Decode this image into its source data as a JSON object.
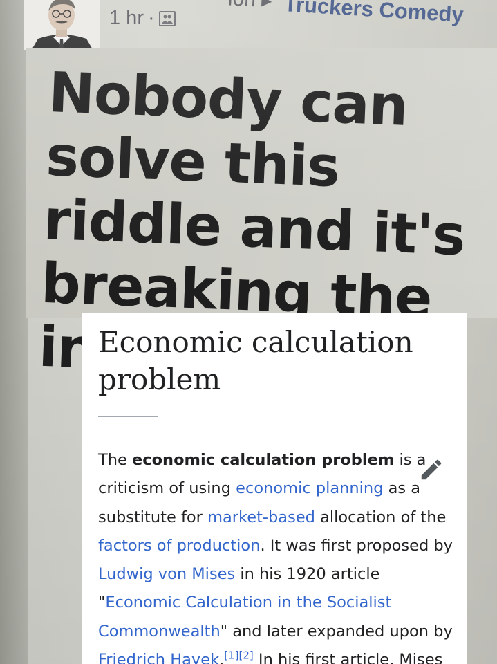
{
  "post": {
    "timestamp": "1 hr",
    "separator": "·",
    "group_name": "Truckers Comedy",
    "headline": "Nobody can solve this riddle and it's breaking the internet"
  },
  "article": {
    "title": "Economic calculation problem",
    "lead": {
      "t1": "The ",
      "bold": "economic calculation problem",
      "t2": " is a criticism of using ",
      "link1": "economic planning",
      "t3": " as a substitute for ",
      "link2": "market-based",
      "t4": " allocation of the ",
      "link3": "factors of production",
      "t5": ". It was first proposed by ",
      "link4": "Ludwig von Mises",
      "t6": " in his 1920 article \"",
      "link5": "Economic Calculation in the Socialist Commonwealth",
      "t7": "\" and later expanded upon by ",
      "link6": "Friedrich Hayek",
      "t8": ".",
      "ref": "[1][2]",
      "t9": " In his first article, Mises"
    }
  },
  "colors": {
    "link": "#3366cc",
    "text": "#202122",
    "group_name": "#3f5587"
  },
  "icons": {
    "avatar": "portrait-photo",
    "audience": "group-audience-icon",
    "edit": "pencil-icon"
  }
}
